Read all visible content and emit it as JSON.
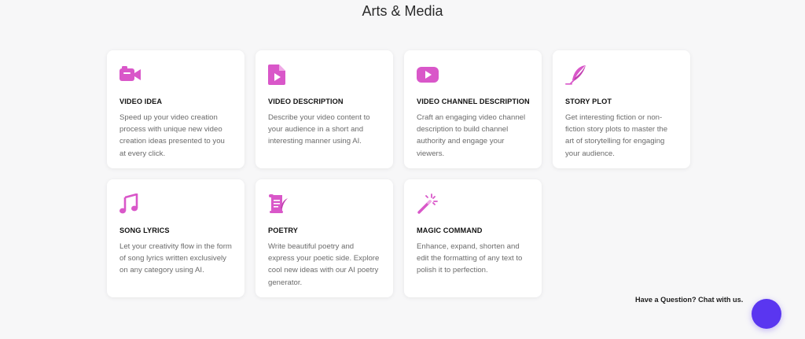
{
  "section": {
    "title": "Arts & Media"
  },
  "accent_color": "#d957c9",
  "cards": [
    {
      "icon": "video-camera-icon",
      "title": "VIDEO IDEA",
      "description": "Speed up your video creation process with unique new video creation ideas presented to you at every click."
    },
    {
      "icon": "play-document-icon",
      "title": "VIDEO DESCRIPTION",
      "description": "Describe your video content to your audience in a short and interesting manner using AI."
    },
    {
      "icon": "youtube-play-icon",
      "title": "VIDEO CHANNEL DESCRIPTION",
      "description": "Craft an engaging video channel description to build channel authority and engage your viewers."
    },
    {
      "icon": "feather-pen-icon",
      "title": "STORY PLOT",
      "description": "Get interesting fiction or non-fiction story plots to master the art of storytelling for engaging your audience."
    },
    {
      "icon": "music-note-icon",
      "title": "SONG LYRICS",
      "description": "Let your creativity flow in the form of song lyrics written exclusively on any category using AI."
    },
    {
      "icon": "poetry-scroll-icon",
      "title": "POETRY",
      "description": "Write beautiful poetry and express your poetic side. Explore cool new ideas with our AI poetry generator."
    },
    {
      "icon": "magic-wand-icon",
      "title": "MAGIC COMMAND",
      "description": "Enhance, expand, shorten and edit the formatting of any text to polish it to perfection."
    }
  ],
  "chat": {
    "prompt": "Have a Question? Chat with us.",
    "button_color": "#5a36f0"
  }
}
